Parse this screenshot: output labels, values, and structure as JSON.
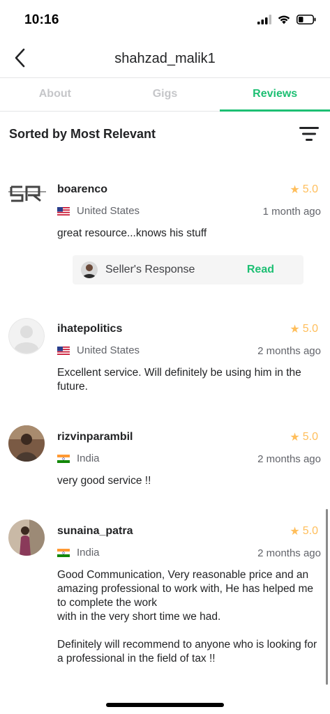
{
  "status_bar": {
    "time": "10:16"
  },
  "nav": {
    "title": "shahzad_malik1"
  },
  "tabs": [
    {
      "label": "About",
      "active": false
    },
    {
      "label": "Gigs",
      "active": false
    },
    {
      "label": "Reviews",
      "active": true
    }
  ],
  "sort": {
    "label": "Sorted by Most Relevant"
  },
  "colors": {
    "accent": "#1dbf73",
    "star": "#ffbe5b"
  },
  "reviews": [
    {
      "username": "boarenco",
      "rating": "5.0",
      "country": "United States",
      "date": "1 month ago",
      "text": "great resource...knows his stuff",
      "seller_response": {
        "label": "Seller's Response",
        "action": "Read"
      }
    },
    {
      "username": "ihatepolitics",
      "rating": "5.0",
      "country": "United States",
      "date": "2 months ago",
      "text": "Excellent service. Will definitely be using him in the future."
    },
    {
      "username": "rizvinparambil",
      "rating": "5.0",
      "country": "India",
      "date": "2 months ago",
      "text": "very good service !!"
    },
    {
      "username": "sunaina_patra",
      "rating": "5.0",
      "country": "India",
      "date": "2 months ago",
      "text": "Good Communication, Very reasonable price and an amazing professional to work with, He has helped me to complete the work\nwith in the very short time we had.\n\nDefinitely will recommend to anyone who is looking for a professional in the field of tax !!"
    }
  ]
}
